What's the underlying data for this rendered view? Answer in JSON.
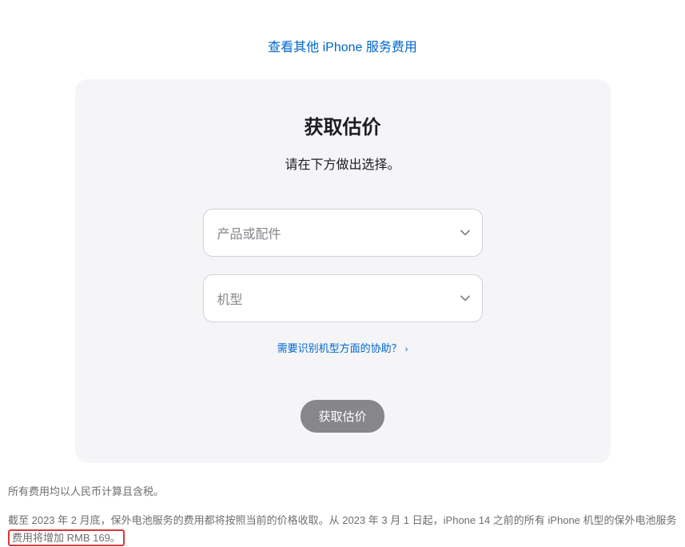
{
  "topLink": {
    "label": "查看其他 iPhone 服务费用"
  },
  "card": {
    "title": "获取估价",
    "subtitle": "请在下方做出选择。",
    "select1": {
      "placeholder": "产品或配件"
    },
    "select2": {
      "placeholder": "机型"
    },
    "helpLink": {
      "label": "需要识别机型方面的协助？"
    },
    "button": {
      "label": "获取估价"
    }
  },
  "footer": {
    "line1": "所有费用均以人民币计算且含税。",
    "line2_part1": "截至 2023 年 2 月底，保外电池服务的费用都将按照当前的价格收取。从 2023 年 3 月 1 日起，iPhone 14 之前的所有 iPhone 机型的保外电池服务",
    "line2_highlight": "费用将增加 RMB 169。"
  }
}
